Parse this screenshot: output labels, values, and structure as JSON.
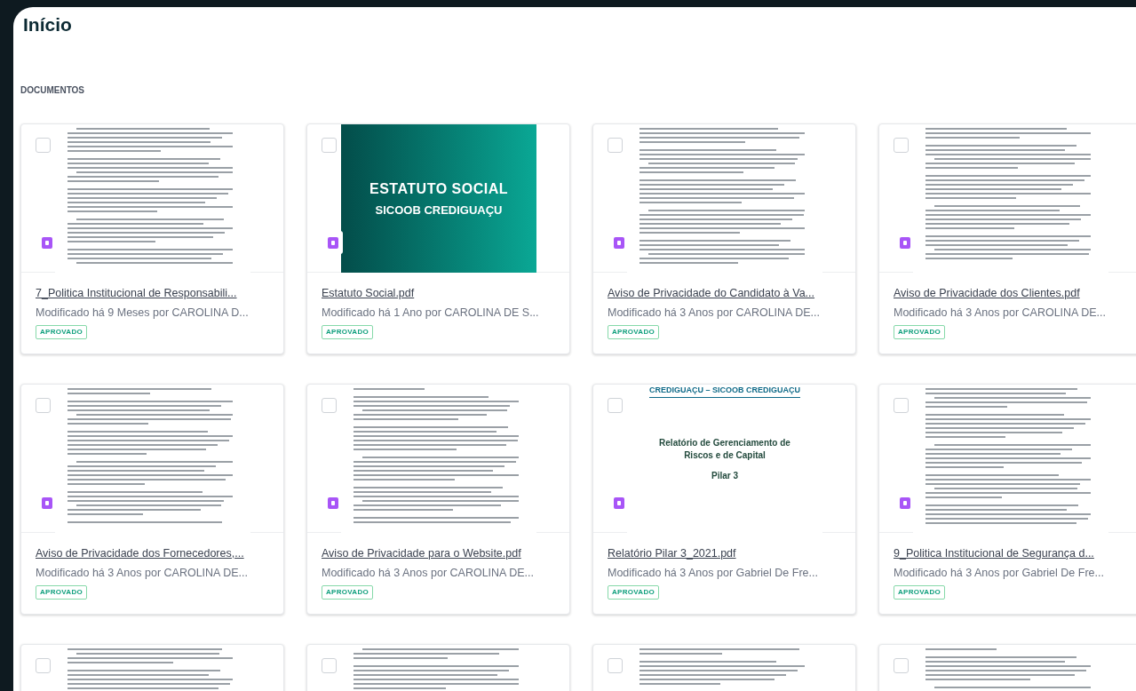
{
  "page_title": "Início",
  "section_label": "DOCUMENTOS",
  "documents": [
    {
      "checked": false,
      "preview": {
        "kind": "lines"
      },
      "title": "7_Politica Institucional de Responsabili...",
      "meta": "Modificado há 9 Meses por CAROLINA D...",
      "status": "APROVADO"
    },
    {
      "checked": false,
      "preview": {
        "kind": "cover",
        "heading": "ESTATUTO SOCIAL",
        "brand": "SICOOB CREDIGUAÇU"
      },
      "title": "Estatuto Social.pdf",
      "meta": "Modificado há 1 Ano por CAROLINA DE S...",
      "status": "APROVADO"
    },
    {
      "checked": false,
      "preview": {
        "kind": "lines"
      },
      "title": "Aviso de Privacidade do Candidato à Va...",
      "meta": "Modificado há 3 Anos por CAROLINA DE...",
      "status": "APROVADO"
    },
    {
      "checked": false,
      "preview": {
        "kind": "lines"
      },
      "title": "Aviso de Privacidade dos Clientes.pdf",
      "meta": "Modificado há 3 Anos por CAROLINA DE...",
      "status": "APROVADO"
    },
    {
      "checked": false,
      "preview": {
        "kind": "lines"
      },
      "title": "Aviso de Privacidade dos Fornecedores,...",
      "meta": "Modificado há 3 Anos por CAROLINA DE...",
      "status": "APROVADO"
    },
    {
      "checked": false,
      "preview": {
        "kind": "lines"
      },
      "title": "Aviso de Privacidade para o Website.pdf",
      "meta": "Modificado há 3 Anos por CAROLINA DE...",
      "status": "APROVADO"
    },
    {
      "checked": false,
      "preview": {
        "kind": "report",
        "header": "CREDIGUAÇU – SICOOB CREDIGUAÇU",
        "heading": "Relatório de Gerenciamento de Riscos e de Capital",
        "subtitle": "Pilar 3"
      },
      "title": "Relatório Pilar 3_2021.pdf",
      "meta": "Modificado há 3 Anos por Gabriel De Fre...",
      "status": "APROVADO"
    },
    {
      "checked": false,
      "preview": {
        "kind": "lines"
      },
      "title": "9_Politica Institucional de Segurança d...",
      "meta": "Modificado há 3 Anos por Gabriel De Fre...",
      "status": "APROVADO"
    },
    {
      "checked": false,
      "preview": {
        "kind": "lines"
      }
    },
    {
      "checked": false,
      "preview": {
        "kind": "lines"
      }
    },
    {
      "checked": false,
      "preview": {
        "kind": "lines"
      }
    },
    {
      "checked": false,
      "preview": {
        "kind": "lines"
      }
    }
  ]
}
